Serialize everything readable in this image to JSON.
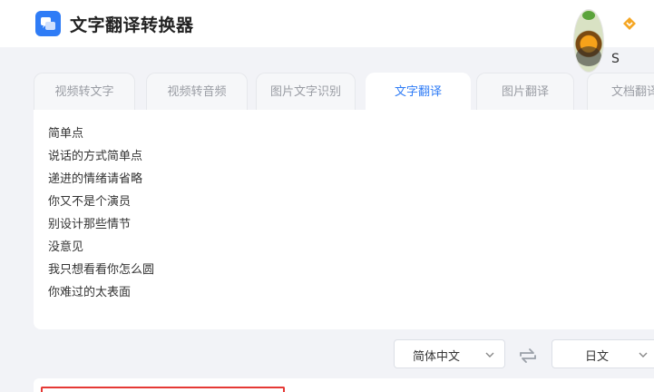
{
  "app": {
    "title": "文字翻译转换器",
    "logo": "chat-translate-logo"
  },
  "user": {
    "name": "S",
    "vip_icon": "diamond-icon",
    "vip_color": "#f5a623"
  },
  "tabs": [
    {
      "label": "视频转文字",
      "active": false
    },
    {
      "label": "视频转音频",
      "active": false
    },
    {
      "label": "图片文字识别",
      "active": false
    },
    {
      "label": "文字翻译",
      "active": true
    },
    {
      "label": "图片翻译",
      "active": false
    },
    {
      "label": "文档翻译",
      "active": false
    }
  ],
  "source": {
    "lines": [
      "简单点",
      "说话的方式简单点",
      "递进的情绪请省略",
      "你又不是个演员",
      "别设计那些情节",
      "没意见",
      "我只想看看你怎么圆",
      "你难过的太表面"
    ]
  },
  "languages": {
    "from": "简体中文",
    "to": "日文",
    "swap_icon": "swap-arrows-icon"
  },
  "colors": {
    "accent": "#2f7cf6",
    "highlight": "#e53935",
    "background": "#f2f3f7"
  }
}
